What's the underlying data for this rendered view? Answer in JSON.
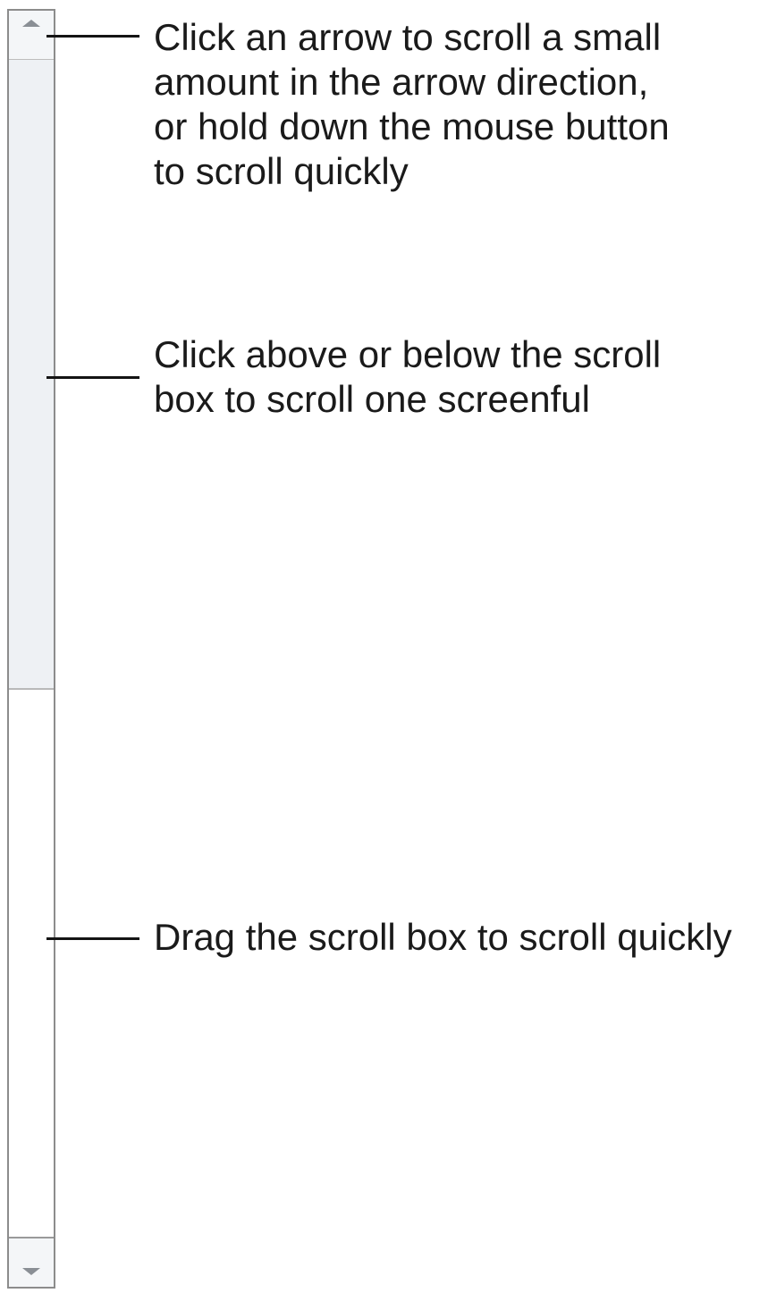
{
  "scrollbar": {
    "up_arrow_icon": "triangle-up",
    "down_arrow_icon": "triangle-down",
    "colors": {
      "border": "#8c8c8c",
      "trough": "#eef1f4",
      "arrow": "#8a8f95",
      "thumb": "#ffffff"
    }
  },
  "callouts": {
    "arrow": {
      "lines": [
        "Click an arrow to scroll a small",
        "amount in the arrow direction,",
        "or hold down the mouse button",
        "to scroll quickly"
      ]
    },
    "trough": {
      "lines": [
        "Click above or below the scroll",
        "box to scroll one screenful"
      ]
    },
    "scroll_box": {
      "lines": [
        "Drag the scroll box to scroll quickly"
      ]
    }
  }
}
